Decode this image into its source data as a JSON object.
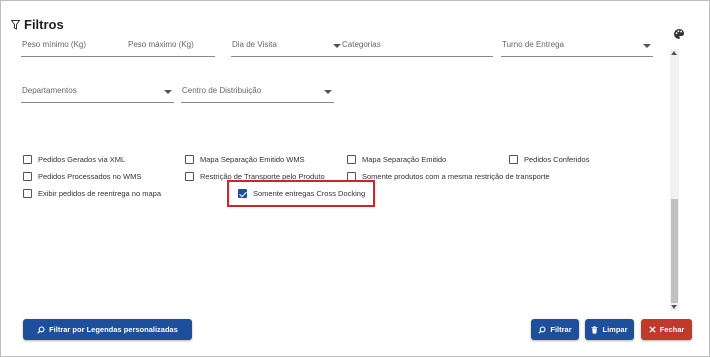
{
  "header": {
    "title": "Filtros",
    "filter_icon": "filter-icon",
    "palette_icon": "palette-icon"
  },
  "fields_row1": [
    {
      "label": "Peso mínimo (Kg)",
      "dropdown": false
    },
    {
      "label": "Peso máximo (Kg)",
      "dropdown": false
    },
    {
      "label": "Dia de Visita",
      "dropdown": true
    },
    {
      "label": "Categorias",
      "dropdown": false
    },
    {
      "label": "Turno de Entrega",
      "dropdown": true
    }
  ],
  "fields_row2": [
    {
      "label": "Departamentos",
      "dropdown": true
    },
    {
      "label": "Centro de Distribuição",
      "dropdown": true
    }
  ],
  "checkboxes": [
    {
      "label": "Pedidos Gerados via XML",
      "checked": false
    },
    {
      "label": "Mapa Separação Emitido WMS",
      "checked": false
    },
    {
      "label": "Mapa Separação Emitido",
      "checked": false
    },
    {
      "label": "Pedidos Conferidos",
      "checked": false
    },
    {
      "label": "Pedidos Processados no WMS",
      "checked": false
    },
    {
      "label": "Restrição de Transporte pelo Produto",
      "checked": false
    },
    {
      "label": "Somente produtos com a mesma restrição de transporte",
      "checked": false
    },
    {
      "label": "Exibir pedidos de reentrega no mapa",
      "checked": false
    },
    {
      "label": "Somente entregas Cross Docking",
      "checked": true
    }
  ],
  "buttons": {
    "legend_filter": {
      "label": "Filtrar por Legendas personalizadas",
      "icon": "search-icon"
    },
    "filter": {
      "label": "Filtrar",
      "icon": "search-icon"
    },
    "clear": {
      "label": "Limpar",
      "icon": "trash-icon"
    },
    "close": {
      "label": "Fechar",
      "icon": "close-icon"
    }
  },
  "colors": {
    "primary": "#1e4f9c",
    "danger": "#c0392b",
    "highlight": "#d2232a"
  }
}
